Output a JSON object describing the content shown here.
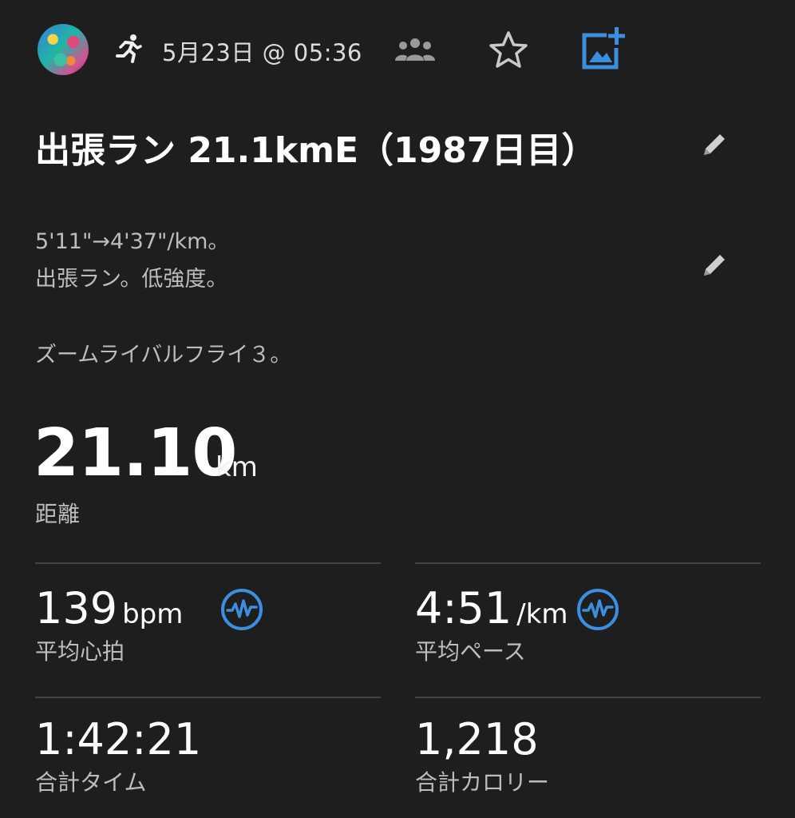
{
  "header": {
    "date": "5月23日 @ 05:36",
    "icons": [
      "avatar",
      "running-icon",
      "group-icon",
      "star-icon",
      "add-photo-icon"
    ],
    "accent_color": "#3b8fe0"
  },
  "activity": {
    "title": "出張ラン 21.1kmE（1987日目）",
    "description": [
      "5'11\"→4'37\"/km。",
      "出張ラン。低強度。",
      "ズームライバルフライ３。"
    ]
  },
  "distance": {
    "value": "21.10",
    "unit": "km",
    "label": "距離"
  },
  "stats": [
    {
      "value": "139",
      "unit": "bpm",
      "label": "平均心拍",
      "icon": "heart-rate-icon"
    },
    {
      "value": "4:51",
      "unit": "/km",
      "label": "平均ペース",
      "icon": "heart-rate-icon"
    },
    {
      "value": "1:42:21",
      "unit": "",
      "label": "合計タイム"
    },
    {
      "value": "1,218",
      "unit": "",
      "label": "合計カロリー"
    }
  ]
}
